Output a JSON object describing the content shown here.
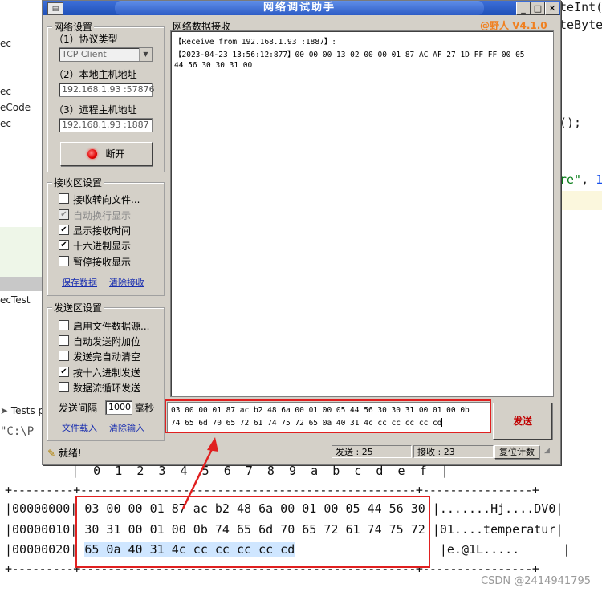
{
  "background_ide": {
    "right_lines": [
      "teInt(",
      "teByte",
      "();",
      "re\", 1"
    ],
    "left_lines": [
      "ec",
      "ec",
      "eCode",
      "ec",
      "ecTest"
    ],
    "tests_label": "Tests p",
    "path_fragment": "\"C:\\P"
  },
  "window": {
    "title": "网络调试助手",
    "version": "@野人 V4.1.0",
    "buttons": {
      "minimize": "_",
      "maximize": "□",
      "close": "✕"
    }
  },
  "net_settings": {
    "group_label": "网络设置",
    "protocol_label": "（1）协议类型",
    "protocol_value": "TCP Client",
    "local_label": "（2）本地主机地址",
    "local_value": "192.168.1.93 :57876",
    "remote_label": "（3）远程主机地址",
    "remote_value": "192.168.1.93 :1887",
    "disconnect_label": "断开"
  },
  "recv_settings": {
    "group_label": "接收区设置",
    "options": [
      {
        "label": "接收转向文件...",
        "checked": false,
        "disabled": false
      },
      {
        "label": "自动换行显示",
        "checked": true,
        "disabled": true
      },
      {
        "label": "显示接收时间",
        "checked": true,
        "disabled": false
      },
      {
        "label": "十六进制显示",
        "checked": true,
        "disabled": false
      },
      {
        "label": "暂停接收显示",
        "checked": false,
        "disabled": false
      }
    ],
    "save_link": "保存数据",
    "clear_link": "清除接收"
  },
  "send_settings": {
    "group_label": "发送区设置",
    "options": [
      {
        "label": "启用文件数据源...",
        "checked": false
      },
      {
        "label": "自动发送附加位",
        "checked": false
      },
      {
        "label": "发送完自动清空",
        "checked": false
      },
      {
        "label": "按十六进制发送",
        "checked": true
      },
      {
        "label": "数据流循环发送",
        "checked": false
      }
    ],
    "interval_label": "发送间隔",
    "interval_value": "1000",
    "interval_unit": "毫秒",
    "load_link": "文件载入",
    "clear_link": "清除输入"
  },
  "receive_panel": {
    "label": "网络数据接收",
    "line1": "【Receive from 192.168.1.93 :1887】:",
    "line2": "【2023-04-23 13:56:12:877】00 00 00 13 02 00 00 01 87 AC AF 27 1D FF FF 00 05",
    "line3": "44 56 30 30 31 00"
  },
  "send_panel": {
    "line1": " 03 00 00 01 87 ac b2 48 6a 00 01 00 05 44 56 30 30 31 00 01 00 0b",
    "line2": "74 65 6d 70 65 72 61 74 75 72 65 0a 40 31 4c cc cc cc cc cd",
    "send_button": "发送"
  },
  "status_bar": {
    "ready": "就绪!",
    "sent": "发送 : 25",
    "received": "接收 : 23",
    "reset": "复位计数"
  },
  "hex_dump": {
    "header": "   |  0  1  2  3  4  5  6  7  8  9  a  b  c  d  e  f  |",
    "separator": "+---------+-------------------------------------------------+----------------+",
    "rows": [
      {
        "offset": "|00000000|",
        "hex": " 03 00 00 01 87 ac b2 48 6a 00 01 00 05 44 56 30 ",
        "ascii": "|.......Hj....DV0|"
      },
      {
        "offset": "|00000010|",
        "hex": " 30 31 00 01 00 0b 74 65 6d 70 65 72 61 74 75 72 ",
        "ascii": "|01....temperatur|"
      },
      {
        "offset": "|00000020|",
        "hex_selected": "65 0a 40 31 4c cc cc cc cc cd",
        "ascii": "|e.@1L.....      |"
      }
    ]
  },
  "watermark": "CSDN @2414941795",
  "colors": {
    "highlight_red": "#e02020",
    "title_blue": "#2d5cc6",
    "version_orange": "#f08020"
  }
}
